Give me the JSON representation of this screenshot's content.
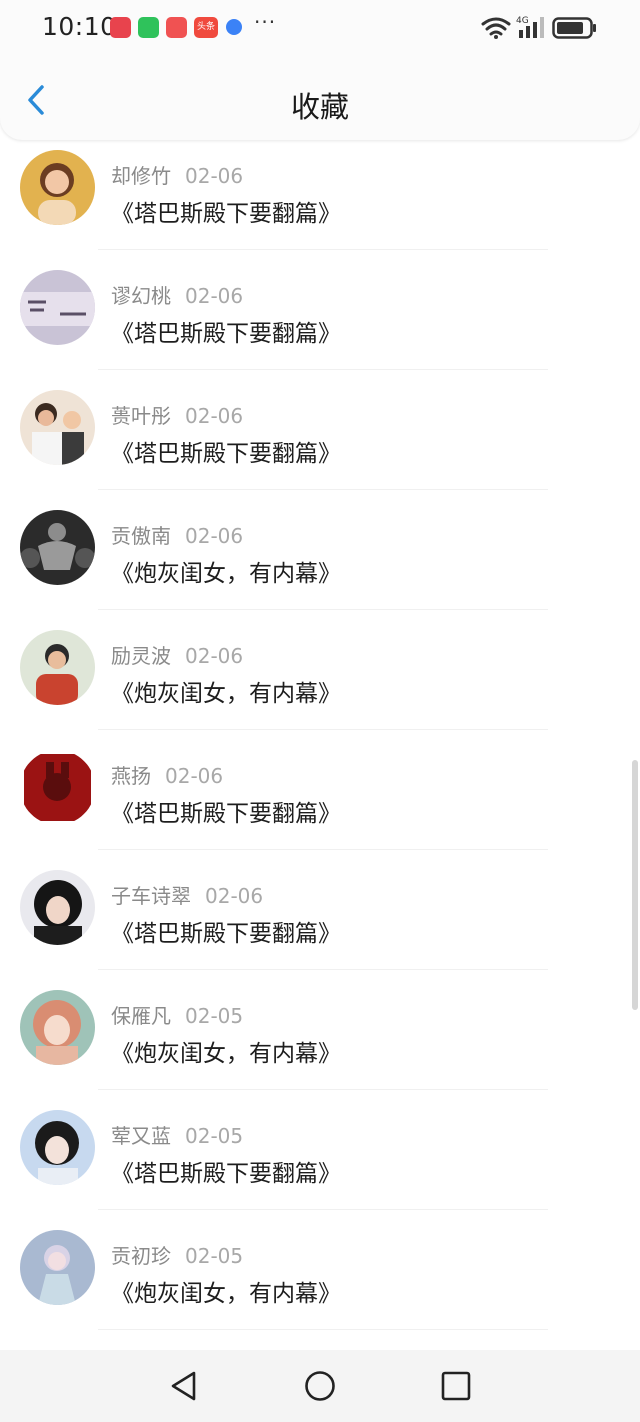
{
  "status_bar": {
    "time": "10:10",
    "notif_badge": "头条",
    "more": "···"
  },
  "header": {
    "title": "收藏"
  },
  "items": [
    {
      "name": "却修竹",
      "date": "02-06",
      "title": "《塔巴斯殿下要翻篇》"
    },
    {
      "name": "谬幻桃",
      "date": "02-06",
      "title": "《塔巴斯殿下要翻篇》"
    },
    {
      "name": "蒉叶彤",
      "date": "02-06",
      "title": "《塔巴斯殿下要翻篇》"
    },
    {
      "name": "贡傲南",
      "date": "02-06",
      "title": "《炮灰闺女，有内幕》"
    },
    {
      "name": "励灵波",
      "date": "02-06",
      "title": "《炮灰闺女，有内幕》"
    },
    {
      "name": "燕扬",
      "date": "02-06",
      "title": "《塔巴斯殿下要翻篇》"
    },
    {
      "name": "子车诗翠",
      "date": "02-06",
      "title": "《塔巴斯殿下要翻篇》"
    },
    {
      "name": "保雁凡",
      "date": "02-05",
      "title": "《炮灰闺女，有内幕》"
    },
    {
      "name": "荤又蓝",
      "date": "02-05",
      "title": "《塔巴斯殿下要翻篇》"
    },
    {
      "name": "贡初珍",
      "date": "02-05",
      "title": "《炮灰闺女，有内幕》"
    }
  ],
  "colors": {
    "accent": "#2a8bd8",
    "name_text": "#8a8a8a",
    "title_text": "#1e1e1e"
  }
}
